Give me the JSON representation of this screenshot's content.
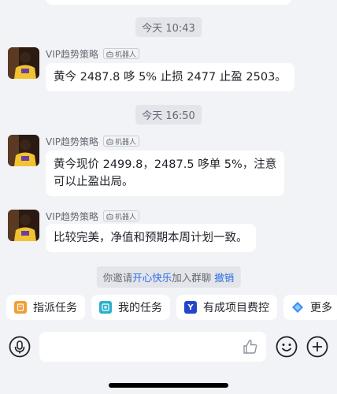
{
  "timestamps": [
    "今天 10:43",
    "今天 16:50"
  ],
  "messages": [
    {
      "sender": "VIP趋势策略",
      "bot_tag": "机器人",
      "lines": [
        "黄今 2487.8 哆 5% 止损 2477 止盈 2503。"
      ]
    },
    {
      "sender": "VIP趋势策略",
      "bot_tag": "机器人",
      "lines": [
        "黄今现价 2499.8，2487.5 哆单 5%，注意",
        "可以止盈出局。"
      ]
    },
    {
      "sender": "VIP趋势策略",
      "bot_tag": "机器人",
      "lines": [
        "比较完美，净值和预期本周计划一致。"
      ]
    }
  ],
  "invite": {
    "prefix": "你邀请",
    "user": "开心快乐",
    "suffix": "加入群聊",
    "action": "撤销"
  },
  "quick_actions": [
    {
      "label": "指派任务",
      "icon": "assign-task-icon",
      "color": "#f29d38"
    },
    {
      "label": "我的任务",
      "icon": "my-task-icon",
      "color": "#2bb0c9"
    },
    {
      "label": "有成项目费控",
      "icon": "project-cost-icon",
      "color": "#2445c9",
      "glyph": "Y"
    },
    {
      "label": "更多",
      "icon": "more-icon",
      "color": "#3b8ff3"
    }
  ],
  "input_bar": {
    "voice_icon": "microphone-icon",
    "like_icon": "thumbs-up-icon",
    "emoji_icon": "emoji-icon",
    "plus_icon": "plus-icon"
  }
}
